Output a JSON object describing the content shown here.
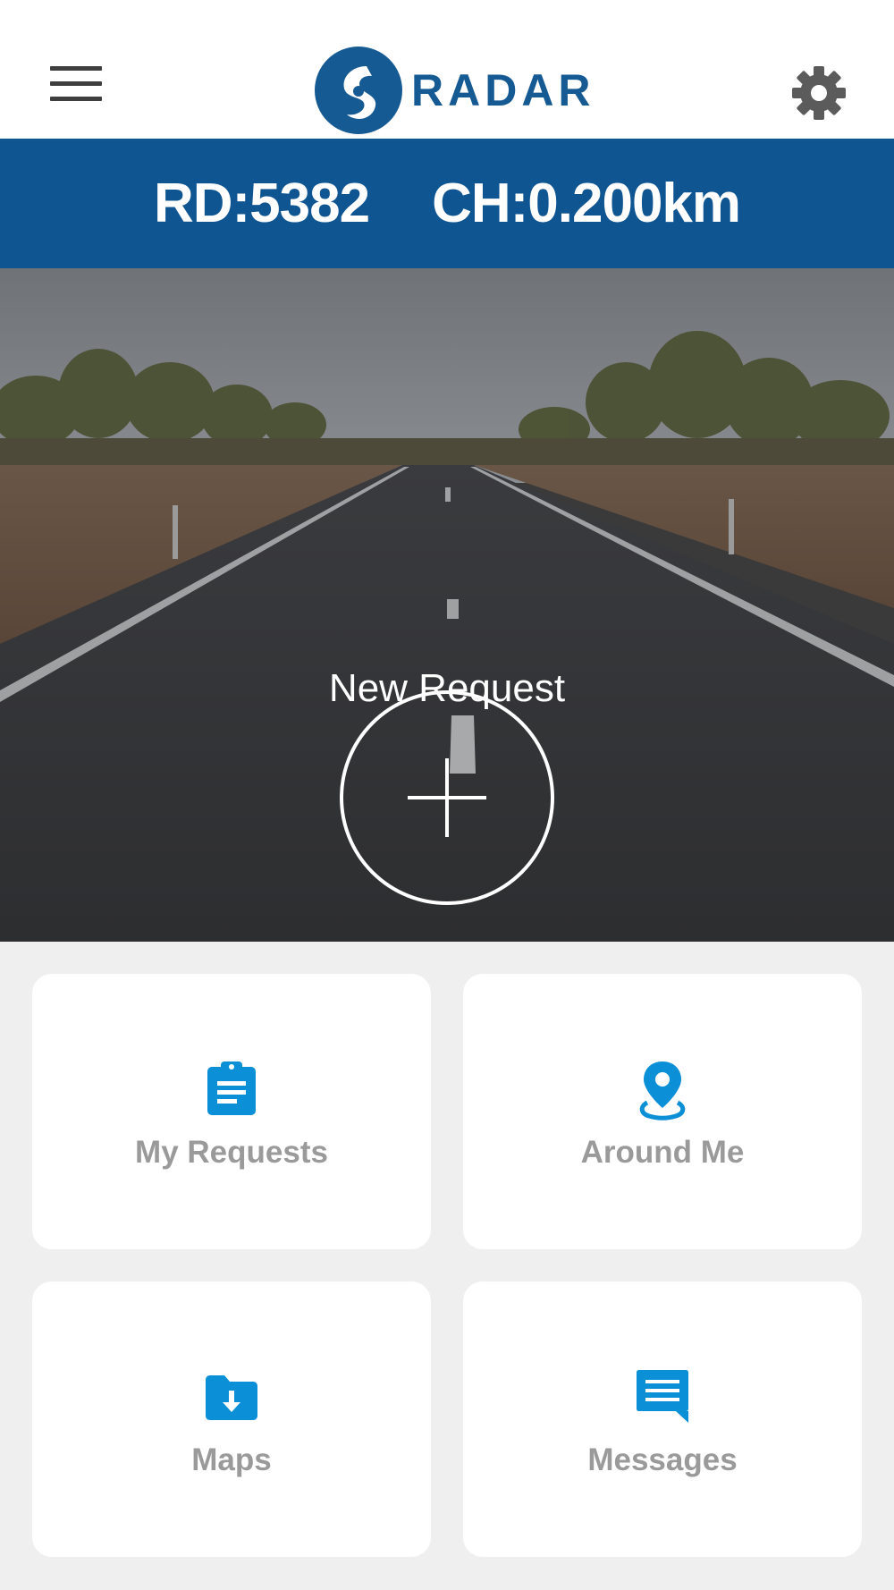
{
  "header": {
    "logo_text": "RADAR",
    "menu_icon": "hamburger-menu-icon",
    "settings_icon": "gear-icon"
  },
  "location": {
    "road": "RD:5382",
    "chainage": "CH:0.200km"
  },
  "hero": {
    "new_request_label": "New Request",
    "button_icon": "plus-icon"
  },
  "tiles": [
    {
      "label": "My Requests",
      "icon": "clipboard-icon"
    },
    {
      "label": "Around Me",
      "icon": "map-pin-icon"
    },
    {
      "label": "Maps",
      "icon": "folder-download-icon"
    },
    {
      "label": "Messages",
      "icon": "message-icon"
    }
  ],
  "colors": {
    "brand_blue": "#0f5592",
    "icon_blue": "#0b8fd6",
    "tile_label_gray": "#9a9a9a",
    "page_background": "#efefef"
  }
}
